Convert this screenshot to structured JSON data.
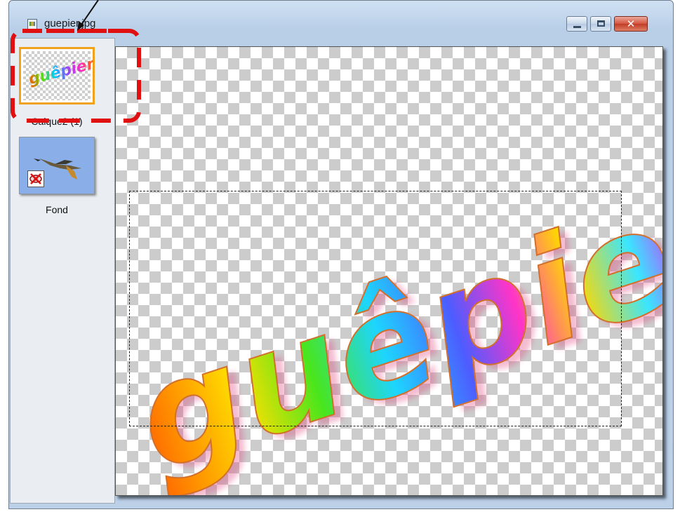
{
  "window": {
    "title": "guepier.jpg",
    "buttons": {
      "minimize": "minimize",
      "maximize": "maximize",
      "close": "✕"
    }
  },
  "layers": [
    {
      "label": "Calque2 (1)",
      "selected": true,
      "thumbnail_text": "guêpier"
    },
    {
      "label": "Fond",
      "selected": false,
      "hidden": true
    }
  ],
  "canvas": {
    "text": "guêpier"
  },
  "colors": {
    "selection_highlight": "#f0a21b",
    "annotation": "#e01010"
  }
}
